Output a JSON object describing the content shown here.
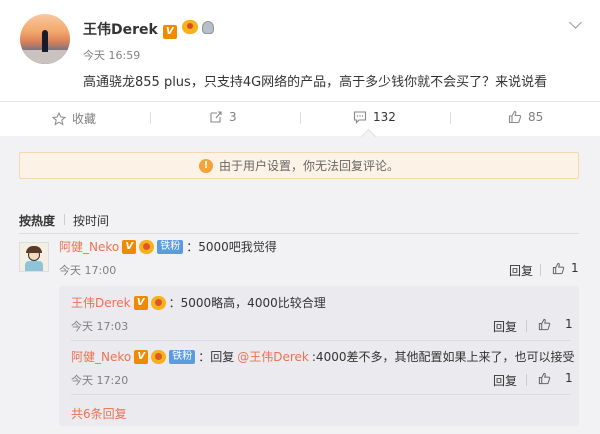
{
  "post": {
    "author": "王伟Derek",
    "time": "今天 16:59",
    "text": "高通骁龙855 plus，只支持4G网络的产品，高于多少钱你就不会买了？来说说看"
  },
  "actions": {
    "favorite": "收藏",
    "repost_count": "3",
    "comment_count": "132",
    "like_count": "85"
  },
  "notice": "由于用户设置，你无法回复评论。",
  "sort": {
    "hot": "按热度",
    "time": "按时间"
  },
  "comment": {
    "author": "阿健_Neko",
    "fan_badge": "铁粉",
    "text": "：5000吧我觉得",
    "time": "今天 17:00",
    "reply_label": "回复",
    "likes": "1"
  },
  "replies": [
    {
      "author": "王伟Derek",
      "text": "：5000略高，4000比较合理",
      "time": "今天 17:03",
      "reply_label": "回复",
      "likes": "1"
    },
    {
      "author": "阿健_Neko",
      "fan_badge": "铁粉",
      "prefix": "：回复",
      "mention": "@王伟Derek",
      "text": ":4000差不多，其他配置如果上来了，也可以接受",
      "time": "今天 17:20",
      "reply_label": "回复",
      "likes": "1"
    }
  ],
  "more_replies": "共6条回复",
  "icons": {
    "verified": "V",
    "warning": "!",
    "like": "👍"
  }
}
